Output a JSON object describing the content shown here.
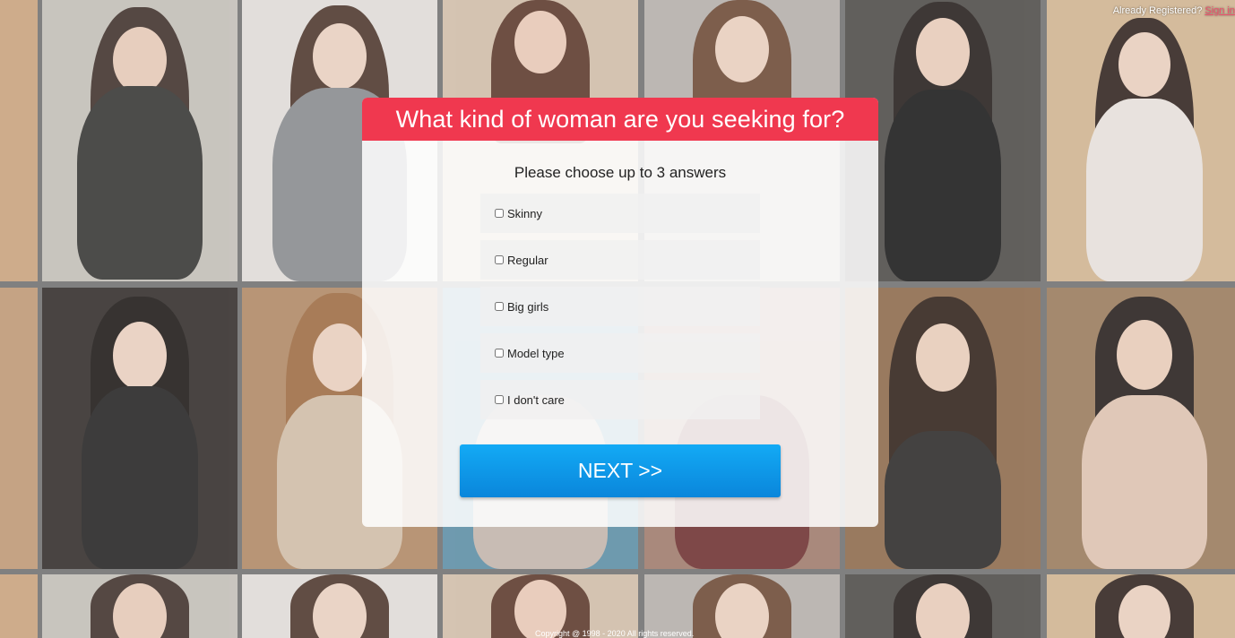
{
  "header": {
    "already_registered": "Already Registered?",
    "sign_in": "Sign in"
  },
  "modal": {
    "title": "What kind of woman are you seeking for?",
    "subtitle": "Please choose up to 3 answers",
    "options": [
      "Skinny",
      "Regular",
      "Big girls",
      "Model type",
      "I don't care"
    ],
    "next_label": "NEXT >>"
  },
  "footer": {
    "copyright": "Copyright @ 1998 - 2020 All rights reserved."
  },
  "colors": {
    "accent_red": "#f0384f",
    "button_blue": "#0a86db",
    "sign_in_pink": "#f0506e"
  }
}
